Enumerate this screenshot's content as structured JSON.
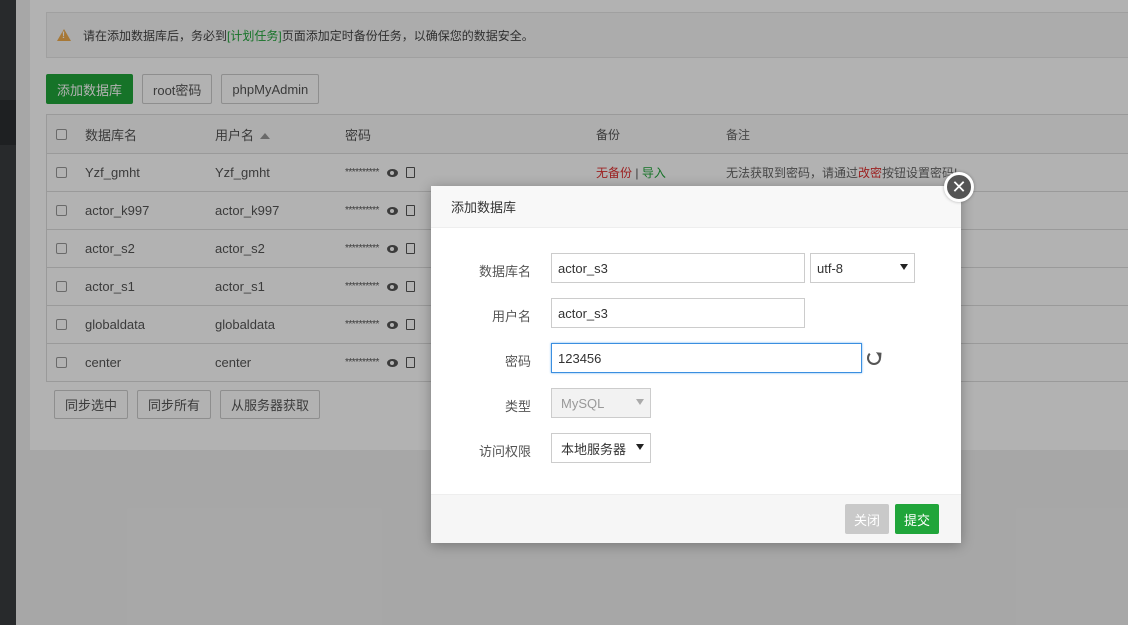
{
  "notice": {
    "text_before": "请在添加数据库后，务必到",
    "link": "[计划任务]",
    "text_after": "页面添加定时备份任务，以确保您的数据安全。"
  },
  "toolbar": {
    "add_db": "添加数据库",
    "root_pw": "root密码",
    "phpmyadmin": "phpMyAdmin"
  },
  "table": {
    "headers": {
      "name": "数据库名",
      "user": "用户名",
      "password": "密码",
      "backup": "备份",
      "note": "备注"
    },
    "rows": [
      {
        "name": "Yzf_gmht",
        "user": "Yzf_gmht",
        "password": "**********"
      },
      {
        "name": "actor_k997",
        "user": "actor_k997",
        "password": "**********"
      },
      {
        "name": "actor_s2",
        "user": "actor_s2",
        "password": "**********"
      },
      {
        "name": "actor_s1",
        "user": "actor_s1",
        "password": "**********"
      },
      {
        "name": "globaldata",
        "user": "globaldata",
        "password": "**********"
      },
      {
        "name": "center",
        "user": "center",
        "password": "**********"
      }
    ],
    "first_row_backup": {
      "none": "无备份",
      "sep": " | ",
      "import": "导入"
    },
    "first_row_note": {
      "before": "无法获取到密码，请通过",
      "link": "改密",
      "after": "按钮设置密码!"
    }
  },
  "footer_buttons": {
    "sync_selected": "同步选中",
    "sync_all": "同步所有",
    "fetch_from_server": "从服务器获取"
  },
  "modal": {
    "title": "添加数据库",
    "close_symbol": "✕",
    "fields": {
      "db_name_label": "数据库名",
      "db_name_value": "actor_s3",
      "charset_value": "utf-8",
      "username_label": "用户名",
      "username_value": "actor_s3",
      "password_label": "密码",
      "password_value": "123456",
      "type_label": "类型",
      "type_value": "MySQL",
      "access_label": "访问权限",
      "access_value": "本地服务器"
    },
    "close_button": "关闭",
    "submit_button": "提交"
  },
  "colors": {
    "accent_green": "#20a53a",
    "warning_red": "#e03030",
    "focus_blue": "#3b8fe0"
  }
}
